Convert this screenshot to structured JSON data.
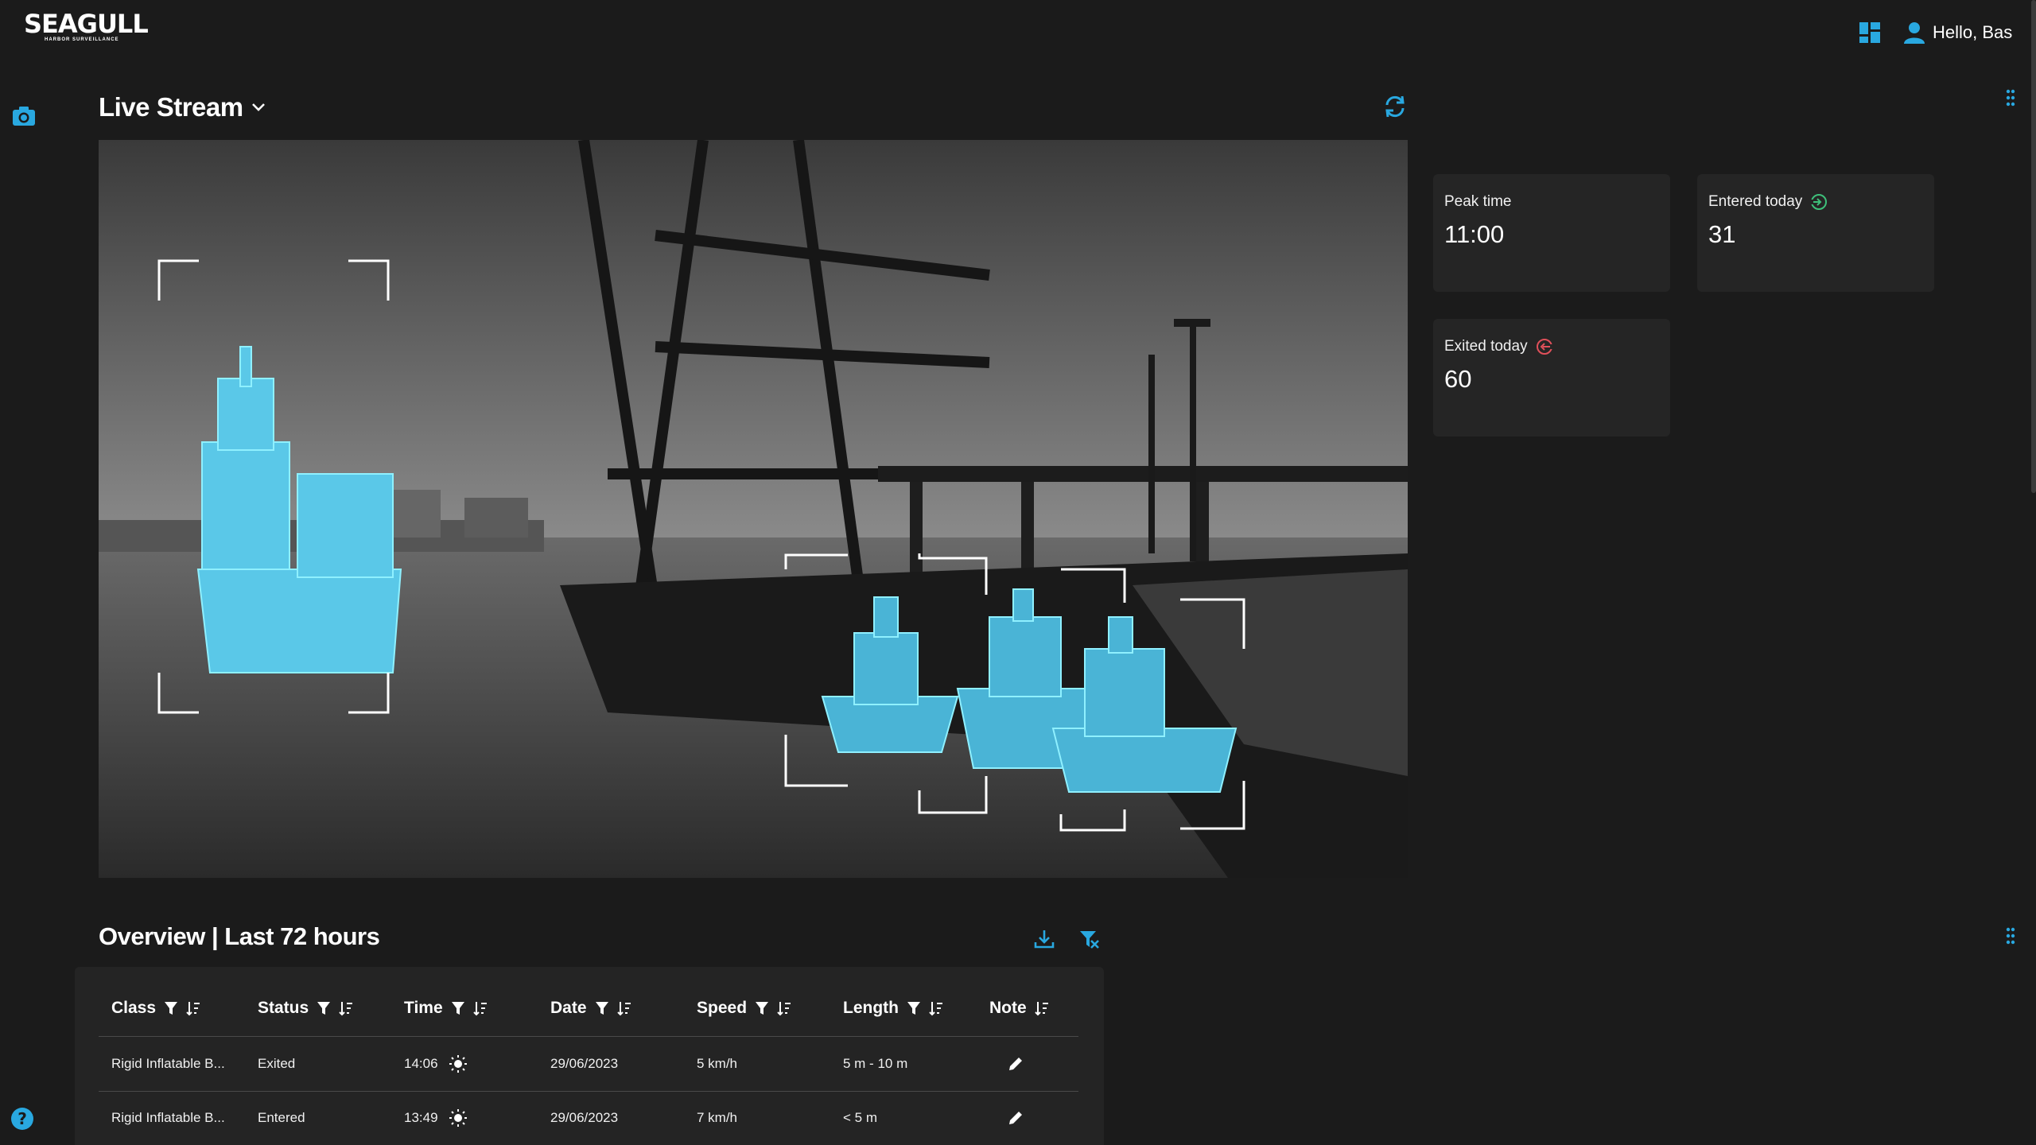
{
  "brand": {
    "name": "SEAGULL",
    "tagline": "HARBOR SURVEILLANCE"
  },
  "header": {
    "greeting": "Hello, Bas"
  },
  "stream": {
    "title": "Live Stream"
  },
  "stats": {
    "peak": {
      "label": "Peak time",
      "value": "11:00"
    },
    "entered": {
      "label": "Entered today",
      "value": "31"
    },
    "exited": {
      "label": "Exited today",
      "value": "60"
    }
  },
  "overview": {
    "title": "Overview | Last 72 hours",
    "columns": [
      "Class",
      "Status",
      "Time",
      "Date",
      "Speed",
      "Length",
      "Note"
    ],
    "rows": [
      {
        "class": "Rigid Inflatable B...",
        "status": "Exited",
        "time": "14:06",
        "date": "29/06/2023",
        "speed": "5 km/h",
        "length": "5 m - 10 m"
      },
      {
        "class": "Rigid Inflatable B...",
        "status": "Entered",
        "time": "13:49",
        "date": "29/06/2023",
        "speed": "7 km/h",
        "length": "< 5 m"
      }
    ]
  },
  "colors": {
    "accent": "#29a8e0",
    "background": "#1b1b1b",
    "card": "#252525",
    "entered": "#3ec07a",
    "exited": "#e0505a",
    "detection": "#4fd6f2"
  },
  "icons": [
    "camera-icon",
    "grid-icon",
    "user-icon",
    "refresh-icon",
    "download-icon",
    "clear-filter-icon",
    "drag-handle-icon",
    "help-icon",
    "filter-icon",
    "sort-icon",
    "sun-icon",
    "edit-icon",
    "enter-icon",
    "exit-icon"
  ]
}
